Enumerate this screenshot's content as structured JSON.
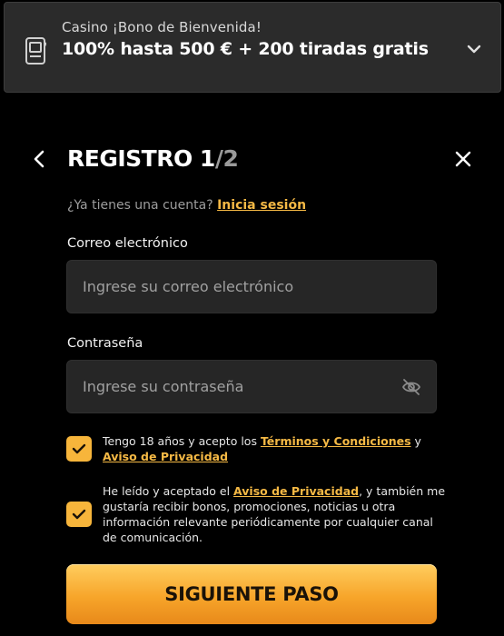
{
  "banner": {
    "subtitle": "Casino ¡Bono de Bienvenida!",
    "title": "100% hasta 500 € + 200 tiradas gratis",
    "icon": "slot-machine-icon"
  },
  "header": {
    "title_main": "REGISTRO 1",
    "title_sep": "/",
    "title_total": "2"
  },
  "login_prompt": {
    "text": "¿Ya tienes una cuenta?",
    "link": "Inicia sesión"
  },
  "form": {
    "email_label": "Correo electrónico",
    "email_placeholder": "Ingrese su correo electrónico",
    "email_value": "",
    "password_label": "Contraseña",
    "password_placeholder": "Ingrese su contraseña",
    "password_value": ""
  },
  "consents": [
    {
      "checked": true,
      "text_before": "Tengo 18 años y acepto los ",
      "link1": "Términos y Condiciones",
      "text_mid": " y ",
      "link2": "Aviso de Privacidad"
    },
    {
      "checked": true,
      "text_before": "He leído y aceptado el ",
      "link1": "Aviso de Privacidad",
      "text_after": ", y también me gustaría recibir bonos, promociones, noticias u otra información relevante periódicamente por cualquier canal de comunicación."
    }
  ],
  "next_button_label": "SIGUIENTE PASO",
  "colors": {
    "accent": "#f7b53b",
    "link": "#f5b945",
    "background": "#000000",
    "field": "#262626"
  }
}
